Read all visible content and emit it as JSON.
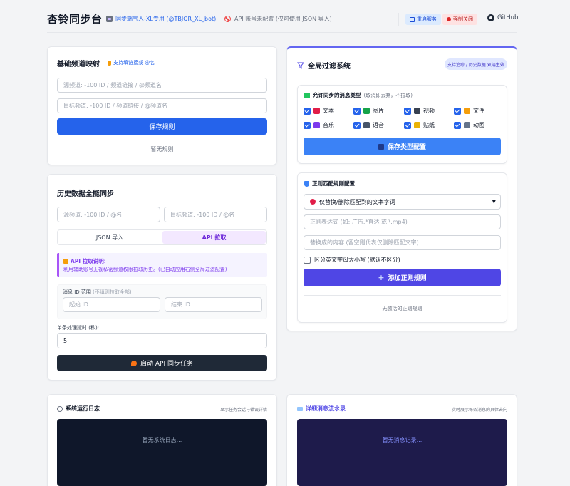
{
  "header": {
    "title": "杏铃同步台",
    "bot_badge": "同步端气人-XL专用 (@TBJQR_XL_bot)",
    "api_status": "API 账号未配置 (仅可使用 JSON 导入)",
    "service_pill": "重启服务",
    "force_close_pill": "强制关闭",
    "github_label": "GitHub"
  },
  "channel_map": {
    "title": "基础频道映射",
    "hint": "支持填链接或 @名",
    "source_placeholder": "源频道: -100 ID / 频道链接 / @频道名",
    "target_placeholder": "目标频道: -100 ID / 频道链接 / @频道名",
    "save_button": "保存规则",
    "empty_text": "暂无规则"
  },
  "history_sync": {
    "title": "历史数据全能同步",
    "source_placeholder": "源频道: -100 ID / @名",
    "target_placeholder": "目标频道: -100 ID / @名",
    "tabs": [
      {
        "label": "JSON 导入",
        "active": false
      },
      {
        "label": "API 拉取",
        "active": true
      }
    ],
    "api_note_title": "API 拉取说明:",
    "api_note_text": "利用辅助账号无视私密频道权限拉取历史。(已自动应用右侧全局过滤配置)",
    "range_label": "消息 ID 范围",
    "range_hint": "(不填则拉取全部)",
    "start_placeholder": "起始 ID",
    "end_placeholder": "结束 ID",
    "delay_label": "单条处理延时 (秒):",
    "delay_value": "5",
    "start_button": "启动 API 同步任务"
  },
  "global_filter": {
    "title": "全局过滤系统",
    "badge": "支持追踪 / 历史数据 双端生效",
    "allowed_types_title": "允许同步的消息类型",
    "allowed_types_hint": "(取消即丢弃，不拉取)",
    "types": [
      {
        "label": "文本",
        "checked": true,
        "icon_color": "#e11d48"
      },
      {
        "label": "图片",
        "checked": true,
        "icon_color": "#16a34a"
      },
      {
        "label": "视频",
        "checked": true,
        "icon_color": "#374151"
      },
      {
        "label": "文件",
        "checked": true,
        "icon_color": "#f59e0b"
      },
      {
        "label": "音乐",
        "checked": true,
        "icon_color": "#7c3aed"
      },
      {
        "label": "语音",
        "checked": true,
        "icon_color": "#475569"
      },
      {
        "label": "贴纸",
        "checked": true,
        "icon_color": "#eab308"
      },
      {
        "label": "动图",
        "checked": true,
        "icon_color": "#64748b"
      }
    ],
    "save_types_button": "保存类型配置",
    "regex_title": "正则匹配规则配置",
    "regex_mode_select": "仅替换/删除匹配到的文本字词",
    "regex_placeholder": "正则表达式 (如: 广告.*直达 或 \\.mp4)",
    "replace_placeholder": "替换成的内容 (留空则代表仅删除匹配文字)",
    "case_label": "区分英文字母大小写 (默认不区分)",
    "add_rule_button": "添加正则规则",
    "no_rules_text": "无激活的正则规则"
  },
  "system_log": {
    "title": "系统运行日志",
    "hint": "显示任务会话与错误详情",
    "empty_text": "暂无系统日志..."
  },
  "message_flow": {
    "title": "详细消息流水录",
    "hint": "实时展示每条消息的具体去向",
    "empty_text": "暂无消息记录..."
  },
  "colors": {
    "primary": "#2563eb",
    "accent_violet": "#4f46e5",
    "dark_button": "#1f2937",
    "log_bg": "#0f172a",
    "flow_bg": "#1e1b4b"
  }
}
